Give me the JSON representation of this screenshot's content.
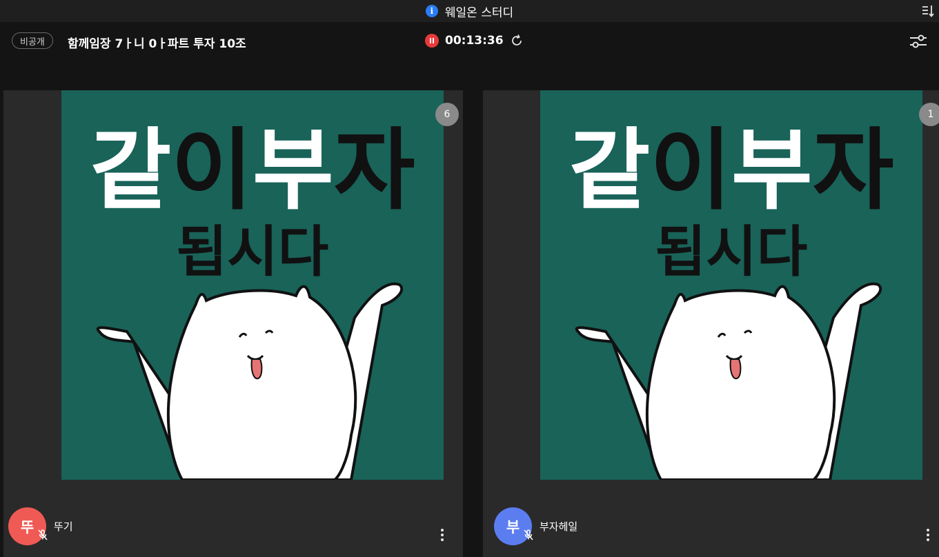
{
  "window": {
    "title": "웨일온 스터디",
    "info_icon": "info-icon",
    "info_glyph": "i",
    "sort_icon": "sort-icon"
  },
  "header": {
    "visibility_badge": "비공개",
    "room_title": "함께임장 7ㅏ니 0ㅏ파트 투자 10조",
    "timer": "00:13:36",
    "record_icon": "pause-record-icon",
    "refresh_icon": "refresh-icon",
    "settings_icon": "settings-sliders-icon"
  },
  "participants": [
    {
      "name": "뚜기",
      "initial": "뚜",
      "avatar_color": "#f05a55",
      "count_badge": "6",
      "poster_line1": "같이부자",
      "poster_line2": "됩시다"
    },
    {
      "name": "부자헤일",
      "initial": "부",
      "avatar_color": "#5b7df0",
      "count_badge": "1",
      "poster_line1": "같이부자",
      "poster_line2": "됩시다"
    }
  ],
  "colors": {
    "poster_bg": "#196359",
    "tile_bg": "#2a2a2a",
    "record_red": "#e83a3a",
    "info_blue": "#2b7cf6"
  }
}
